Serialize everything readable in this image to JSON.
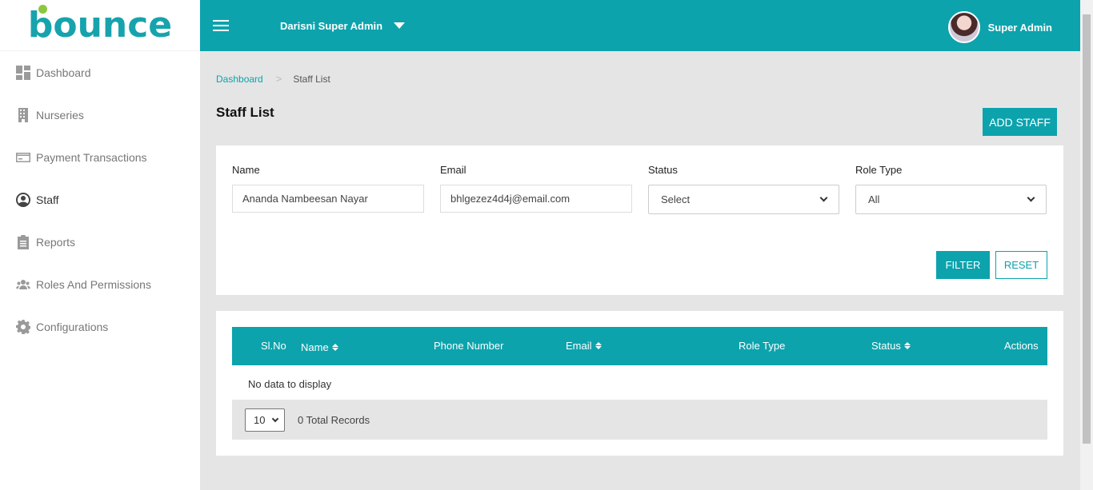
{
  "brand": {
    "logo_text": "bounce"
  },
  "header": {
    "admin_select": "Darisni Super Admin",
    "user_name": "Super Admin"
  },
  "sidebar": {
    "items": [
      {
        "label": "Dashboard",
        "icon": "dashboard-icon"
      },
      {
        "label": "Nurseries",
        "icon": "building-icon"
      },
      {
        "label": "Payment Transactions",
        "icon": "credit-card-icon"
      },
      {
        "label": "Staff",
        "icon": "user-circle-icon",
        "active": true
      },
      {
        "label": "Reports",
        "icon": "clipboard-icon"
      },
      {
        "label": "Roles And Permissions",
        "icon": "users-icon"
      },
      {
        "label": "Configurations",
        "icon": "gear-icon"
      }
    ]
  },
  "breadcrumb": {
    "home": "Dashboard",
    "separator": ">",
    "current": "Staff List"
  },
  "page": {
    "title": "Staff List",
    "add_button": "ADD STAFF"
  },
  "filters": {
    "name_label": "Name",
    "name_value": "Ananda Nambeesan Nayar",
    "email_label": "Email",
    "email_value": "bhlgezez4d4j@email.com",
    "status_label": "Status",
    "status_value": "Select",
    "role_label": "Role Type",
    "role_value": "All",
    "filter_button": "FILTER",
    "reset_button": "RESET"
  },
  "table": {
    "columns": [
      "Sl.No",
      "Name",
      "Phone Number",
      "Email",
      "Role Type",
      "Status",
      "Actions"
    ],
    "empty_message": "No data to display",
    "page_size": "10",
    "total_records": "0 Total Records"
  },
  "colors": {
    "accent": "#0ca3ad",
    "logo_dot": "#8dc63f"
  }
}
